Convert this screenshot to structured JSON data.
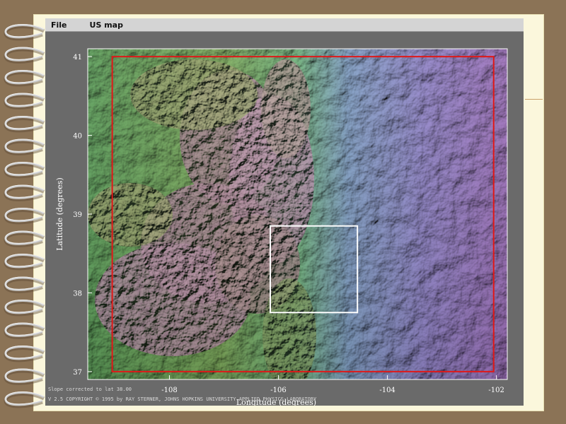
{
  "menubar": {
    "file_label": "File",
    "usmap_label": "US map"
  },
  "map": {
    "type": "shaded-relief elevation map",
    "lon_range": [
      -109.5,
      -101.8
    ],
    "lat_range": [
      36.9,
      41.1
    ],
    "x_ticks": [
      "-108",
      "-106",
      "-104",
      "-102"
    ],
    "y_ticks": [
      "41",
      "40",
      "39",
      "38",
      "37"
    ],
    "y_axis_label": "Latitude (degrees)",
    "x_axis_label": "Longitude (degrees)",
    "red_boundary_box": {
      "lon": [
        -109.05,
        -102.05
      ],
      "lat": [
        37.0,
        41.0
      ]
    },
    "white_selection_box": {
      "lon": [
        -106.15,
        -104.55
      ],
      "lat": [
        37.75,
        38.85
      ]
    },
    "colors": {
      "red_box": "#e01818",
      "white_box": "#ffffff"
    }
  },
  "status": {
    "line1": "Slope corrected to lat 38.00",
    "line2": "V 2.5  COPYRIGHT © 1995 by RAY STERNER, JOHNS HOPKINS UNIVERSITY APPLIED PHYSICS LABORATORY"
  }
}
